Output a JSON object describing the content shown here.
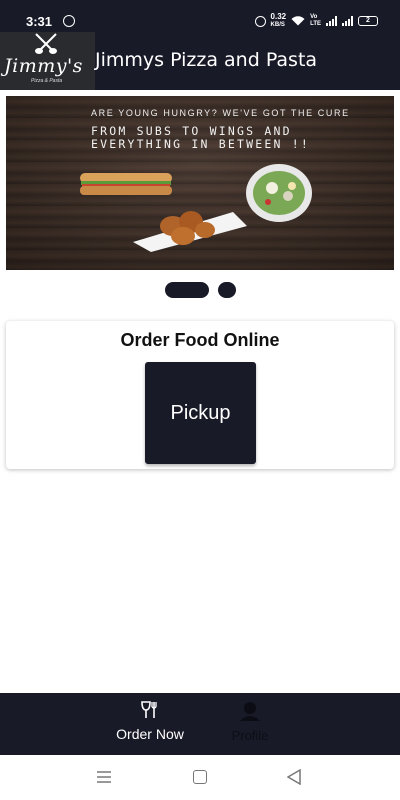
{
  "status_bar": {
    "time": "3:31",
    "speed_value": "0.32",
    "speed_unit": "KB/S",
    "volte_top": "Vo",
    "volte_bottom": "LTE",
    "battery": "2"
  },
  "header": {
    "logo_text": "Jimmy's",
    "logo_subtext": "Pizza & Pasta",
    "title": "Jimmys Pizza and Pasta"
  },
  "banner": {
    "tagline": "ARE YOUNG HUNGRY? WE'VE GOT THE CURE",
    "headline_line1": "FROM SUBS TO WINGS AND",
    "headline_line2": "EVERYTHING IN BETWEEN !!"
  },
  "carousel": {
    "slides": 2,
    "active": 1
  },
  "order_section": {
    "title": "Order Food Online",
    "pickup_label": "Pickup"
  },
  "bottom_nav": {
    "items": [
      {
        "label": "Order Now",
        "icon": "utensils-icon",
        "active": true
      },
      {
        "label": "Profile",
        "icon": "user-icon",
        "active": false
      }
    ]
  },
  "colors": {
    "primary": "#181a28",
    "background": "#ffffff"
  }
}
